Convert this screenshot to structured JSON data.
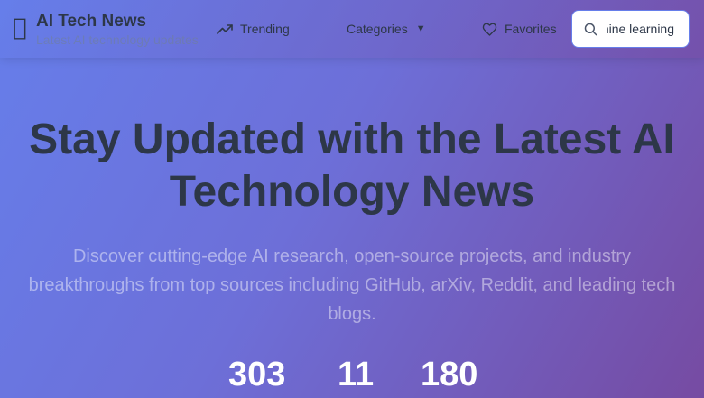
{
  "header": {
    "brand_title": "AI Tech News",
    "brand_subtitle": "Latest AI technology updates",
    "nav": {
      "trending": "Trending",
      "categories": "Categories",
      "favorites": "Favorites"
    },
    "search": {
      "value": "machine learning"
    }
  },
  "hero": {
    "title": "Stay Updated with the Latest AI Technology News",
    "description": "Discover cutting-edge AI research, open-source projects, and industry breakthroughs from top sources including GitHub, arXiv, Reddit, and leading tech blogs."
  },
  "stats": [
    "303",
    "11",
    "180"
  ],
  "colors": {
    "gradient_start": "#667eea",
    "gradient_end": "#764ba2",
    "text_dark": "#2d3748",
    "search_border": "#667eea"
  }
}
